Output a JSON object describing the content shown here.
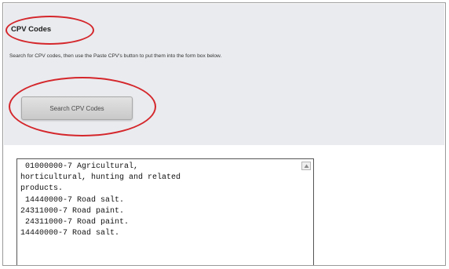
{
  "section": {
    "title": "CPV Codes",
    "instructions": "Search for CPV codes, then use the Paste CPV's button to put them into the form box below."
  },
  "search_button": {
    "label": "Search CPV Codes"
  },
  "codes_box": {
    "lines": [
      " 01000000-7 Agricultural,",
      "horticultural, hunting and related",
      "products.",
      " 14440000-7 Road salt.",
      "24311000-7 Road paint.",
      " 24311000-7 Road paint.",
      "14440000-7 Road salt."
    ]
  },
  "colors": {
    "highlight": "#d4262b",
    "panel_background": "#e9ebee"
  },
  "icons": {
    "scroll": "scroll-up-arrow-icon"
  }
}
